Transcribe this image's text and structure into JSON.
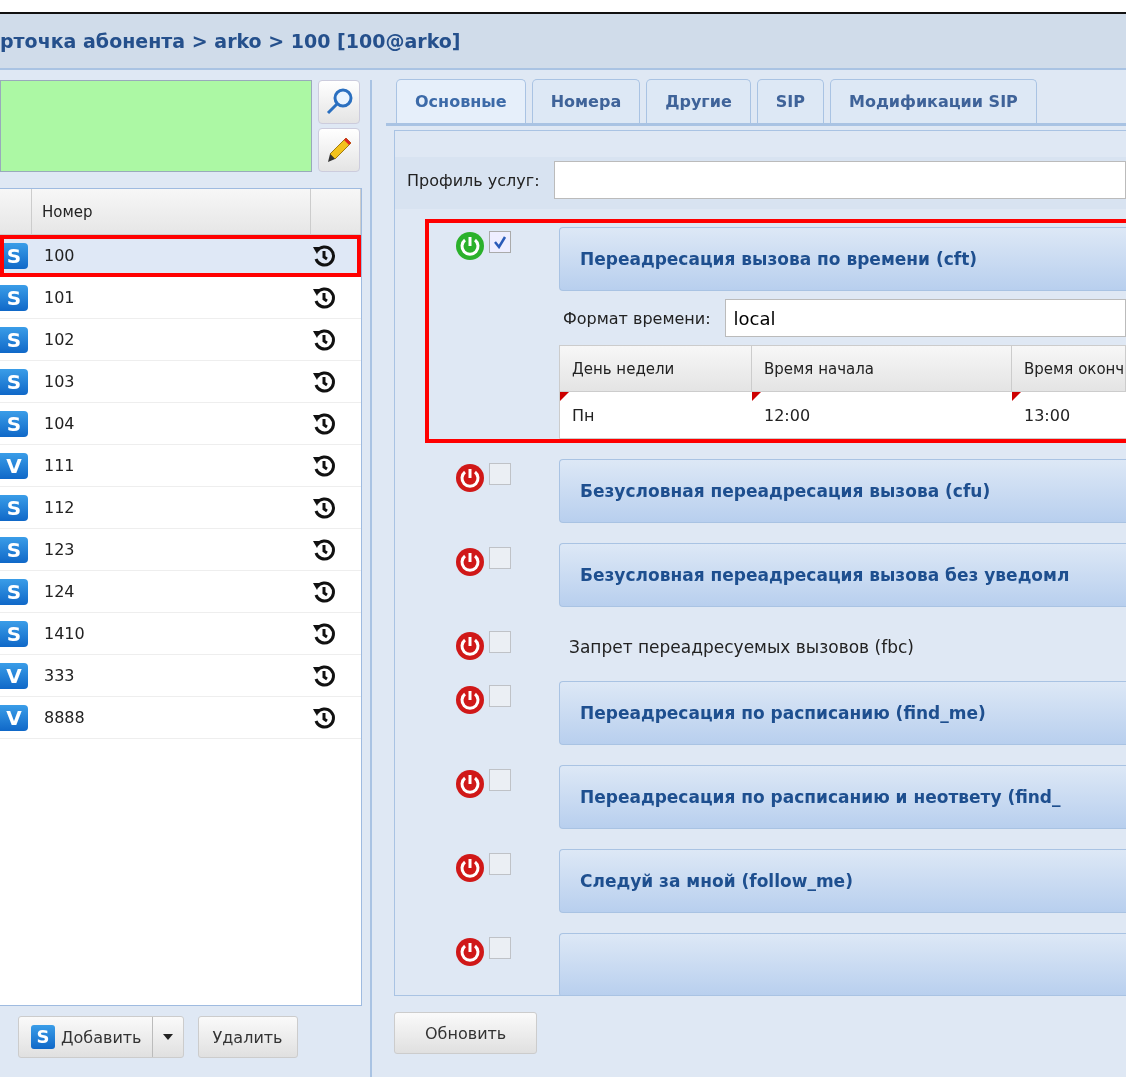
{
  "title": "рточка абонента > arko > 100 [100@arko]",
  "left": {
    "header": "Номер",
    "rows": [
      {
        "type": "S",
        "number": "100",
        "selected": true,
        "highlighted": true
      },
      {
        "type": "S",
        "number": "101",
        "selected": false,
        "highlighted": false
      },
      {
        "type": "S",
        "number": "102",
        "selected": false,
        "highlighted": false
      },
      {
        "type": "S",
        "number": "103",
        "selected": false,
        "highlighted": false
      },
      {
        "type": "S",
        "number": "104",
        "selected": false,
        "highlighted": false
      },
      {
        "type": "V",
        "number": "111",
        "selected": false,
        "highlighted": false
      },
      {
        "type": "S",
        "number": "112",
        "selected": false,
        "highlighted": false
      },
      {
        "type": "S",
        "number": "123",
        "selected": false,
        "highlighted": false
      },
      {
        "type": "S",
        "number": "124",
        "selected": false,
        "highlighted": false
      },
      {
        "type": "S",
        "number": "1410",
        "selected": false,
        "highlighted": false
      },
      {
        "type": "V",
        "number": "333",
        "selected": false,
        "highlighted": false
      },
      {
        "type": "V",
        "number": "8888",
        "selected": false,
        "highlighted": false
      }
    ],
    "add_button": {
      "icon_letter": "S",
      "label": "Добавить"
    },
    "delete_button": "Удалить"
  },
  "tabs": [
    {
      "label": "Основные",
      "selected": true
    },
    {
      "label": "Номера",
      "selected": false
    },
    {
      "label": "Другие",
      "selected": false
    },
    {
      "label": "SIP",
      "selected": false
    },
    {
      "label": "Модификации SIP",
      "selected": false
    }
  ],
  "profile_label": "Профиль услуг:",
  "services": [
    {
      "kind": "panel",
      "title": "Переадресация вызова по времени (cft)",
      "on": true,
      "checked": true,
      "highlighted": true,
      "format_label": "Формат времени:",
      "format_value": "local",
      "table": {
        "columns": [
          "День недели",
          "Время начала",
          "Время оконч"
        ],
        "rows": [
          [
            "Пн",
            "12:00",
            "13:00"
          ]
        ]
      }
    },
    {
      "kind": "panel",
      "title": "Безусловная переадресация вызова (cfu)",
      "on": false,
      "checked": false,
      "highlighted": false
    },
    {
      "kind": "panel",
      "title": "Безусловная переадресация вызова без уведомл",
      "on": false,
      "checked": false,
      "highlighted": false
    },
    {
      "kind": "plain",
      "title": "Запрет переадресуемых вызовов (fbc)",
      "on": false,
      "checked": false,
      "highlighted": false
    },
    {
      "kind": "panel",
      "title": "Переадресация по расписанию (find_me)",
      "on": false,
      "checked": false,
      "highlighted": false
    },
    {
      "kind": "panel",
      "title": "Переадресация по расписанию и неответу (find_",
      "on": false,
      "checked": false,
      "highlighted": false
    },
    {
      "kind": "panel",
      "title": "Следуй за мной (follow_me)",
      "on": false,
      "checked": false,
      "highlighted": false
    },
    {
      "kind": "panel",
      "on": false,
      "checked": false,
      "highlighted": false
    }
  ],
  "refresh_button": "Обновить"
}
